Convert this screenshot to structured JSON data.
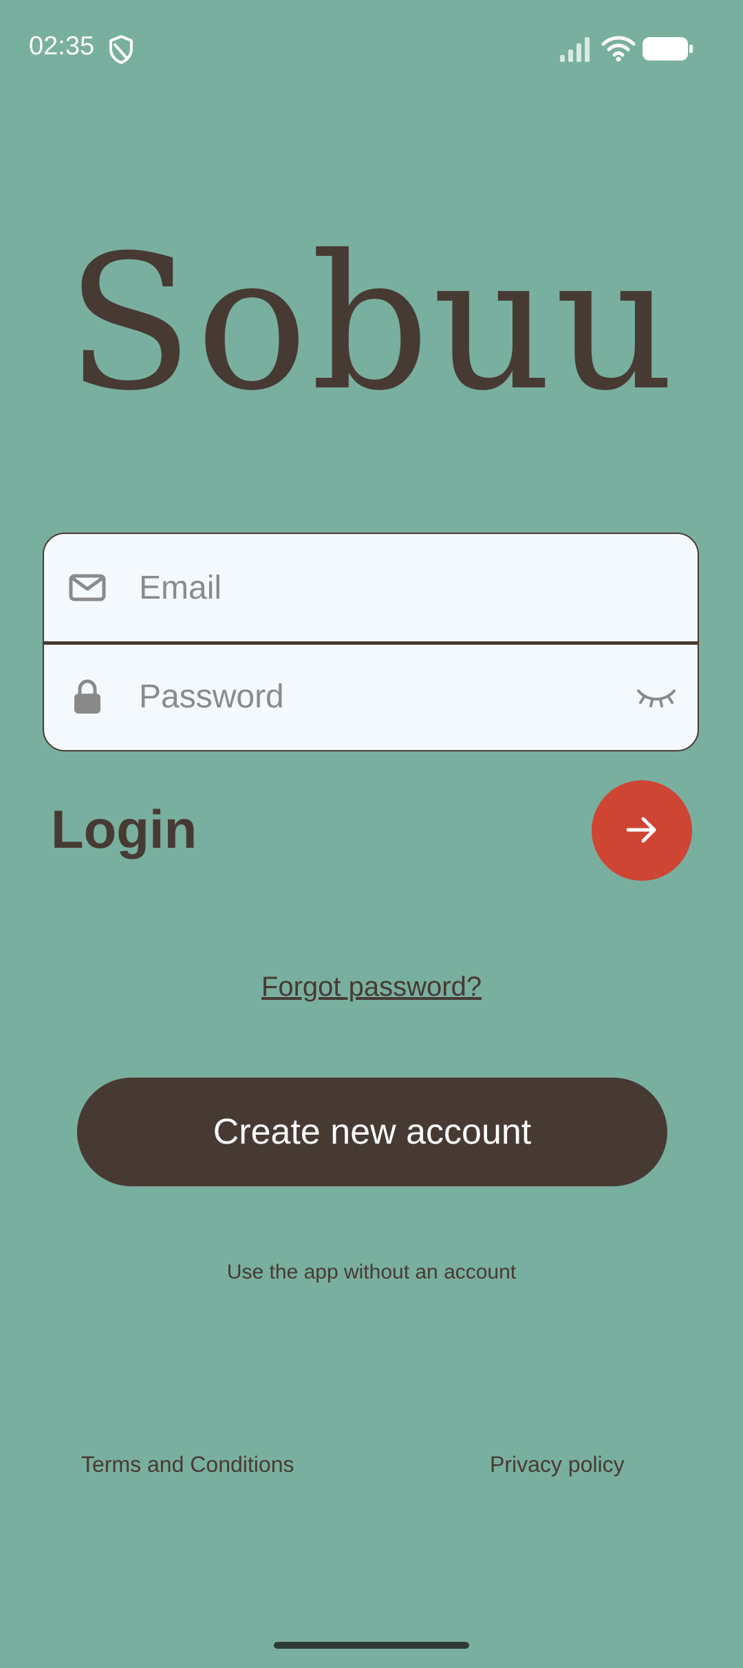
{
  "status_bar": {
    "time": "02:35",
    "icons": [
      "shield-icon",
      "signal-icon",
      "wifi-icon",
      "battery-icon"
    ]
  },
  "brand": {
    "name": "Sobuu"
  },
  "login_form": {
    "email_placeholder": "Email",
    "email_value": "",
    "password_placeholder": "Password",
    "password_value": "",
    "email_icon": "mail-icon",
    "password_icon": "lock-icon",
    "password_toggle_icon": "eye-closed-icon"
  },
  "login": {
    "label": "Login",
    "submit_icon": "arrow-right-icon"
  },
  "links": {
    "forgot_password": "Forgot password?",
    "create_account": "Create new account",
    "guest": "Use the app without an account",
    "terms": "Terms and Conditions",
    "privacy": "Privacy policy"
  },
  "colors": {
    "background": "#79AF9F",
    "primary_dark": "#473A33",
    "accent": "#CF4534",
    "field_background": "#F4F9FD",
    "placeholder": "#8A8A8A"
  }
}
